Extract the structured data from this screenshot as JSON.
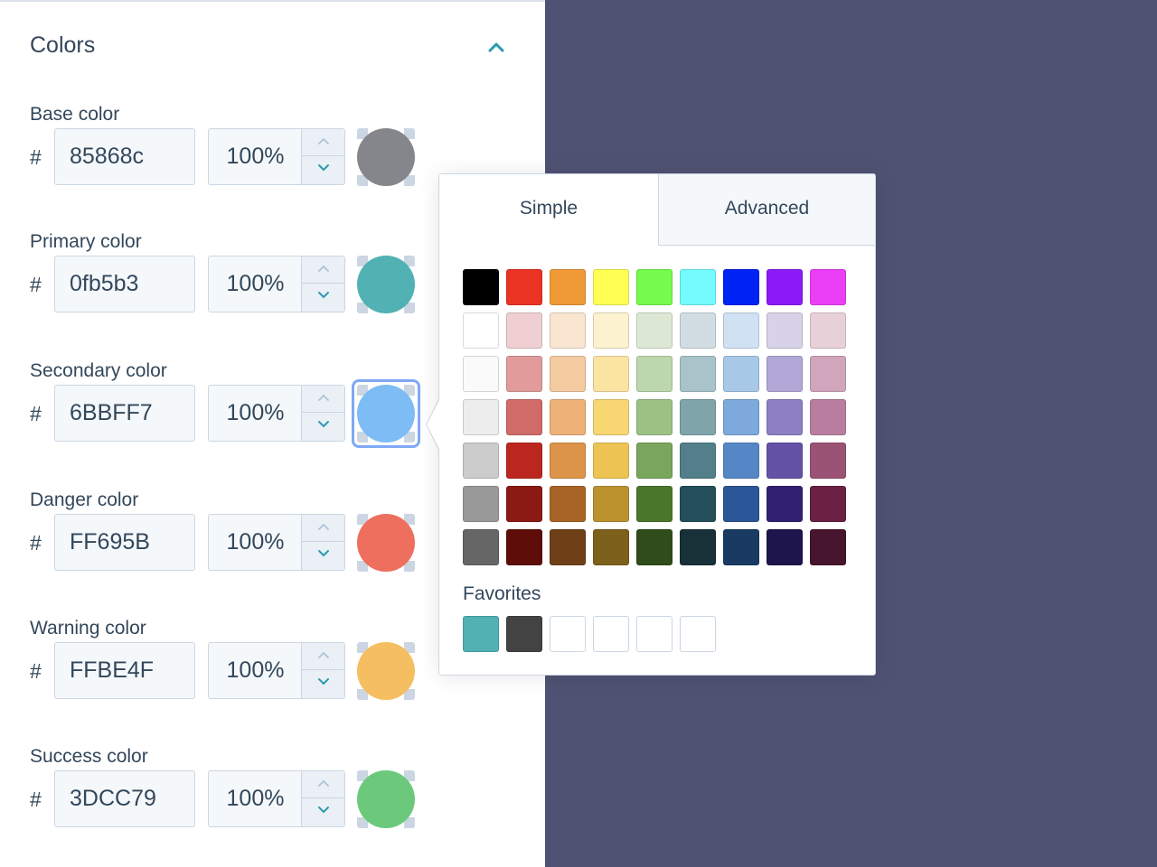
{
  "panel": {
    "title": "Colors",
    "collapse_icon": "chevron-up-icon",
    "accent": "#2c9aaf"
  },
  "fields": [
    {
      "label": "Base color",
      "hash": "#",
      "hex": "85868c",
      "opacity": "100%",
      "swatch": "#85868c"
    },
    {
      "label": "Primary color",
      "hash": "#",
      "hex": "0fb5b3",
      "opacity": "100%",
      "swatch": "#51b1b3"
    },
    {
      "label": "Secondary color",
      "hash": "#",
      "hex": "6BBFF7",
      "opacity": "100%",
      "swatch": "#7dbcf5",
      "active": true
    },
    {
      "label": "Danger color",
      "hash": "#",
      "hex": "FF695B",
      "opacity": "100%",
      "swatch": "#ee6f5e"
    },
    {
      "label": "Warning color",
      "hash": "#",
      "hex": "FFBE4F",
      "opacity": "100%",
      "swatch": "#f5be60"
    },
    {
      "label": "Success color",
      "hash": "#",
      "hex": "3DCC79",
      "opacity": "100%",
      "swatch": "#6cc97c"
    }
  ],
  "picker": {
    "tabs": [
      {
        "label": "Simple",
        "selected": true
      },
      {
        "label": "Advanced",
        "selected": false
      }
    ],
    "palette": [
      [
        "#000000",
        "#ea3323",
        "#f09a37",
        "#ffff54",
        "#75fb4c",
        "#73fbfd",
        "#0023f5",
        "#8c1af6",
        "#ea3ff7"
      ],
      [
        "#ffffff",
        "#efcfd2",
        "#f9e5d0",
        "#fdf2cf",
        "#dce8d4",
        "#d1dde3",
        "#cfe1f3",
        "#d8d2e8",
        "#e8d0d9"
      ],
      [
        "#fafafa",
        "#e09b9a",
        "#f4cba1",
        "#fbe4a2",
        "#bcd7ac",
        "#a9c3cb",
        "#a8c8e8",
        "#b2a8d8",
        "#d1a6bd"
      ],
      [
        "#ededed",
        "#d06b69",
        "#ecb277",
        "#f8d672",
        "#9dc185",
        "#7fa5ab",
        "#7ea9dc",
        "#8c7fc2",
        "#b97e9f"
      ],
      [
        "#cccccc",
        "#bb271e",
        "#dc944a",
        "#edc353",
        "#7aa55c",
        "#527f8a",
        "#5587c6",
        "#6452a7",
        "#9a5275"
      ],
      [
        "#999999",
        "#8c1a14",
        "#a86426",
        "#bc922f",
        "#4b772d",
        "#244f5a",
        "#2b5697",
        "#322073",
        "#6a2143"
      ],
      [
        "#666666",
        "#5f0d08",
        "#6f4017",
        "#7c601b",
        "#2f4c1a",
        "#183038",
        "#193a62",
        "#1f154d",
        "#47152d"
      ]
    ],
    "favorites_label": "Favorites",
    "favorites": [
      "#51b1b3",
      "#434343",
      "#ffffff",
      "#ffffff",
      "#ffffff",
      "#ffffff"
    ]
  }
}
